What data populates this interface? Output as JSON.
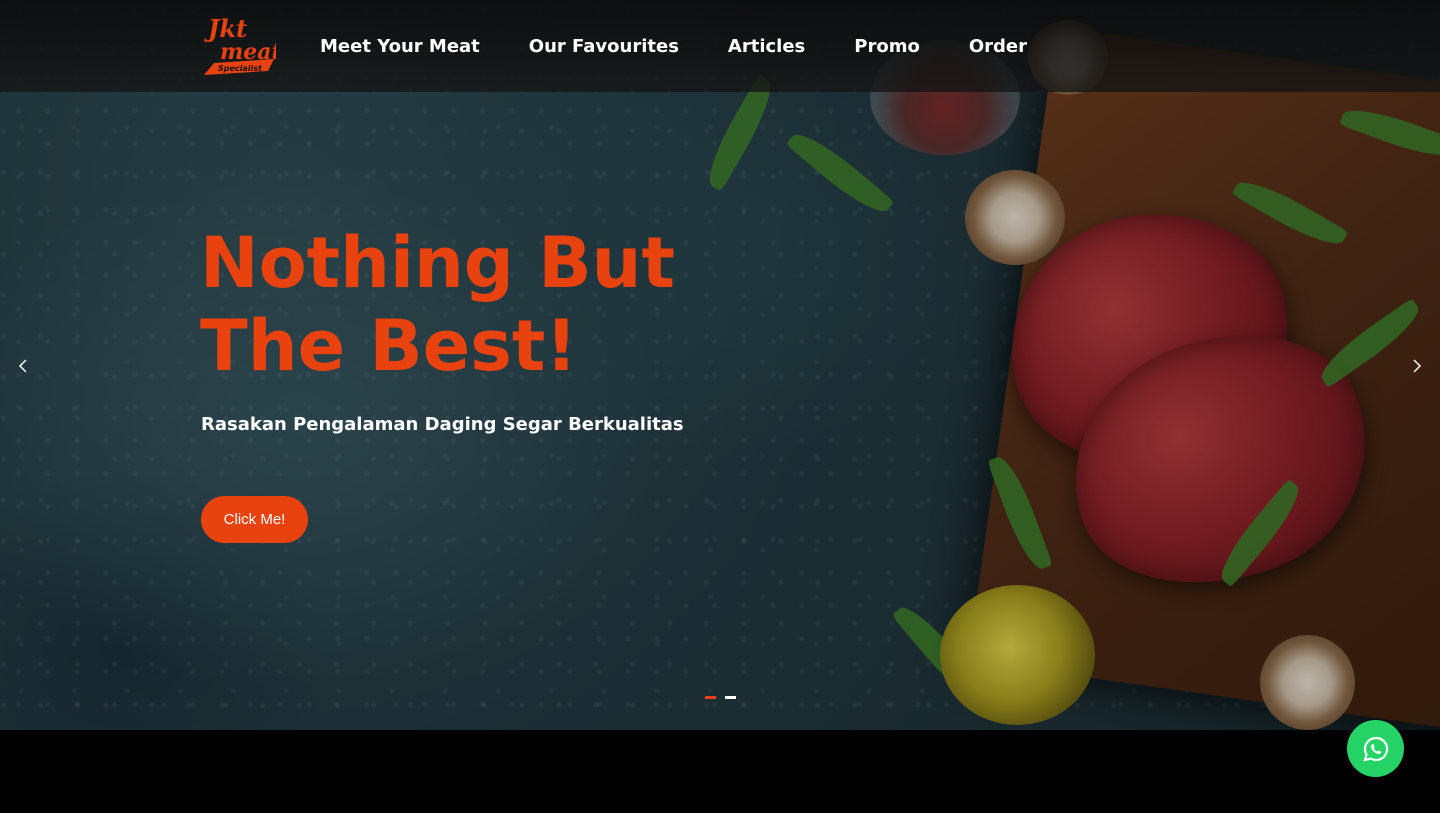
{
  "brand": {
    "logo_line1": "Jkt",
    "logo_line2": "meat",
    "logo_tagline": "Specialist",
    "accent_color": "#e8420f"
  },
  "nav": {
    "items": [
      {
        "label": "Meet Your Meat"
      },
      {
        "label": "Our Favourites"
      },
      {
        "label": "Articles"
      },
      {
        "label": "Promo"
      },
      {
        "label": "Order"
      }
    ]
  },
  "hero": {
    "headline_line1": "Nothing But",
    "headline_line2": "The Best!",
    "subheadline": "Rasakan Pengalaman Daging Segar Berkualitas",
    "cta_label": "Click Me!",
    "slides_total": 2,
    "active_slide": 1
  },
  "icons": {
    "prev": "chevron-left-icon",
    "next": "chevron-right-icon",
    "whatsapp": "whatsapp-icon"
  },
  "colors": {
    "whatsapp": "#25d366",
    "header_bg": "#141414"
  }
}
